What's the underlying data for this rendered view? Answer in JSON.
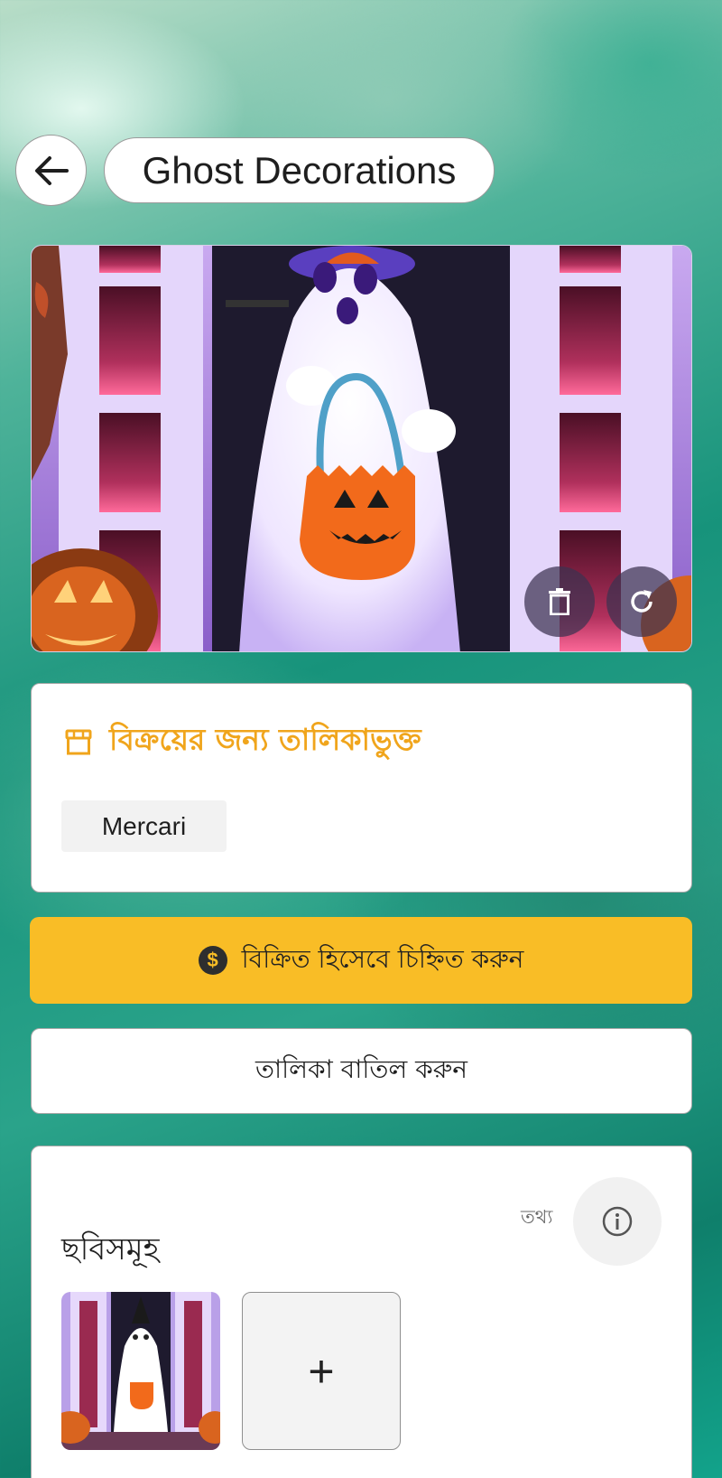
{
  "header": {
    "title": "Ghost Decorations",
    "back_icon": "arrow-left-icon"
  },
  "hero": {
    "actions": [
      "trash-icon",
      "refresh-icon"
    ]
  },
  "listing": {
    "title": "বিক্রয়ের জন্য তালিকাভুক্ত",
    "icon": "store-icon",
    "marketplace": "Mercari"
  },
  "actions": {
    "mark_sold_label": "বিক্রিত হিসেবে চিহ্নিত করুন",
    "mark_sold_icon": "dollar-coin-icon",
    "cancel_listing_label": "তালিকা বাতিল করুন"
  },
  "photos": {
    "title": "ছবিসমূহ",
    "info_label": "তথ্য",
    "add_label": "+"
  },
  "colors": {
    "accent_orange": "#f0a51c",
    "sold_button": "#f9bd26",
    "background_teal": "#17937b"
  }
}
